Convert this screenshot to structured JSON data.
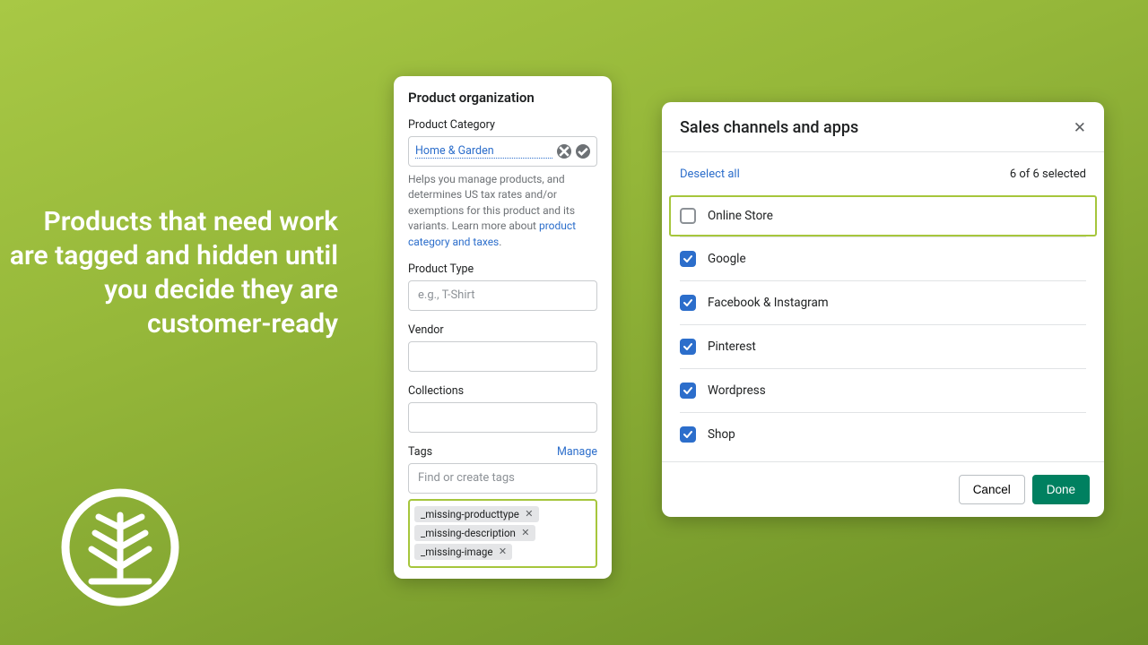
{
  "hero": "Products that need work are tagged and hidden until you decide they are customer-ready",
  "org": {
    "title": "Product organization",
    "category_label": "Product Category",
    "category_value": "Home & Garden",
    "help_text_1": "Helps you manage products, and determines US tax rates and/or exemptions for this product and its variants. Learn more about ",
    "help_link": "product category and taxes",
    "help_text_2": ".",
    "type_label": "Product Type",
    "type_placeholder": "e.g., T-Shirt",
    "vendor_label": "Vendor",
    "collections_label": "Collections",
    "tags_label": "Tags",
    "manage_label": "Manage",
    "tags_placeholder": "Find or create tags",
    "tags": [
      "_missing-producttype",
      "_missing-description",
      "_missing-image"
    ]
  },
  "modal": {
    "title": "Sales channels and apps",
    "deselect": "Deselect all",
    "count": "6 of 6 selected",
    "channels": [
      {
        "name": "Online Store",
        "checked": false,
        "highlighted": true
      },
      {
        "name": "Google",
        "checked": true
      },
      {
        "name": "Facebook & Instagram",
        "checked": true
      },
      {
        "name": "Pinterest",
        "checked": true
      },
      {
        "name": "Wordpress",
        "checked": true
      },
      {
        "name": "Shop",
        "checked": true
      }
    ],
    "cancel": "Cancel",
    "done": "Done"
  }
}
